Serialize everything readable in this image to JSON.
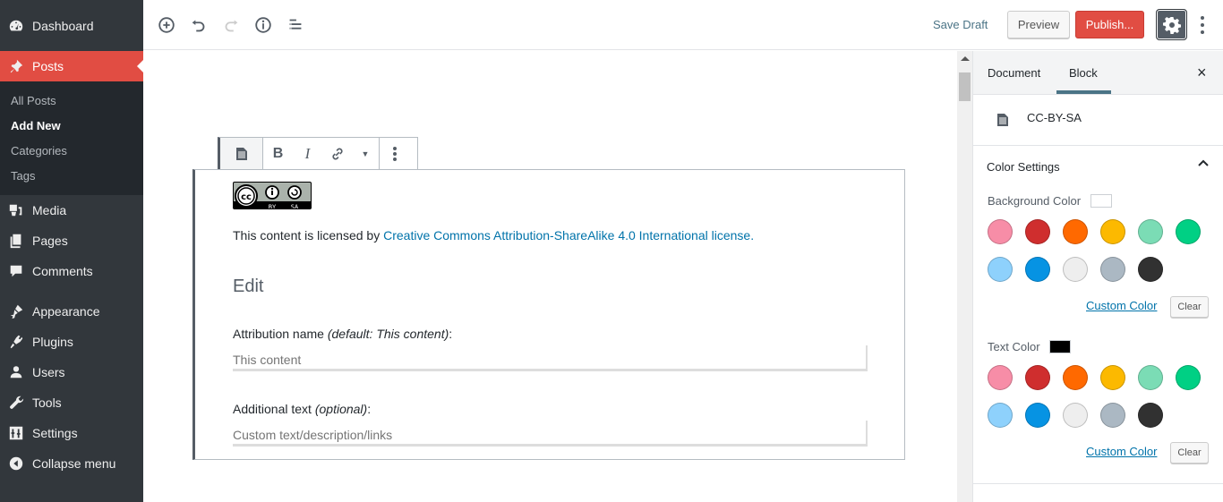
{
  "admin_menu": {
    "items": [
      {
        "label": "Dashboard",
        "icon": "dashboard-icon"
      },
      {
        "label": "Posts",
        "icon": "pin-icon",
        "current": true
      },
      {
        "label": "Media",
        "icon": "media-icon"
      },
      {
        "label": "Pages",
        "icon": "pages-icon"
      },
      {
        "label": "Comments",
        "icon": "comment-icon"
      },
      {
        "label": "Appearance",
        "icon": "brush-icon"
      },
      {
        "label": "Plugins",
        "icon": "plugin-icon"
      },
      {
        "label": "Users",
        "icon": "user-icon"
      },
      {
        "label": "Tools",
        "icon": "wrench-icon"
      },
      {
        "label": "Settings",
        "icon": "settings-icon"
      },
      {
        "label": "Collapse menu",
        "icon": "collapse-icon"
      }
    ],
    "submenu": [
      {
        "label": "All Posts"
      },
      {
        "label": "Add New",
        "current": true
      },
      {
        "label": "Categories"
      },
      {
        "label": "Tags"
      }
    ]
  },
  "topbar": {
    "save_draft": "Save Draft",
    "preview": "Preview",
    "publish": "Publish..."
  },
  "sidebar": {
    "tabs": [
      {
        "label": "Document"
      },
      {
        "label": "Block",
        "active": true
      }
    ],
    "close": "×",
    "block_name": "CC-BY-SA",
    "panel_title": "Color Settings",
    "background_label": "Background Color",
    "text_label": "Text Color",
    "background_current": "#ffffff",
    "text_current": "#000000",
    "custom_color": "Custom Color",
    "clear": "Clear",
    "palette": [
      "#f78da7",
      "#cf2e2e",
      "#ff6900",
      "#fcb900",
      "#7bdcb5",
      "#00d084",
      "#8ed1fc",
      "#0693e3",
      "#eeeeee",
      "#abb8c3",
      "#313131"
    ]
  },
  "block": {
    "badge": {
      "cc": "cc",
      "by": "BY",
      "sa": "SA"
    },
    "license_prefix": "This content is licensed by ",
    "license_link": "Creative Commons Attribution-ShareAlike 4.0 International license.",
    "edit_heading": "Edit",
    "attribution_label": "Attribution name ",
    "attribution_hint": "(default: This content)",
    "attribution_placeholder": "This content",
    "additional_label": "Additional text ",
    "additional_hint": "(optional)",
    "additional_placeholder": "Custom text/description/links",
    "colon": ":"
  }
}
